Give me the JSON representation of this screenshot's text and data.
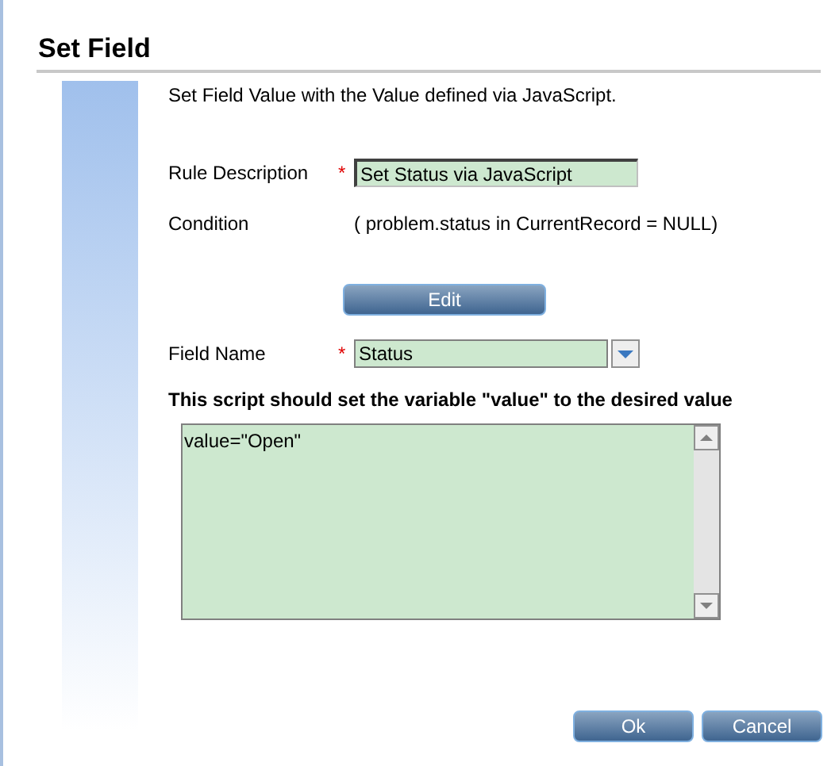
{
  "title": "Set Field",
  "description": "Set Field Value with the Value defined via JavaScript.",
  "fields": [
    {
      "kind": "text",
      "label": "Rule Description",
      "required_mark": "*",
      "value": "Set Status via JavaScript"
    },
    {
      "kind": "static",
      "label": "Condition",
      "value": "( problem.status in CurrentRecord = NULL)"
    },
    {
      "kind": "button",
      "label": "Edit"
    },
    {
      "kind": "select",
      "label": "Field Name",
      "required_mark": "*",
      "value": "Status"
    }
  ],
  "script_label": "This script should set the variable \"value\" to the desired value",
  "script": "value=\"Open\"",
  "buttons": [
    "Ok",
    "Cancel"
  ]
}
